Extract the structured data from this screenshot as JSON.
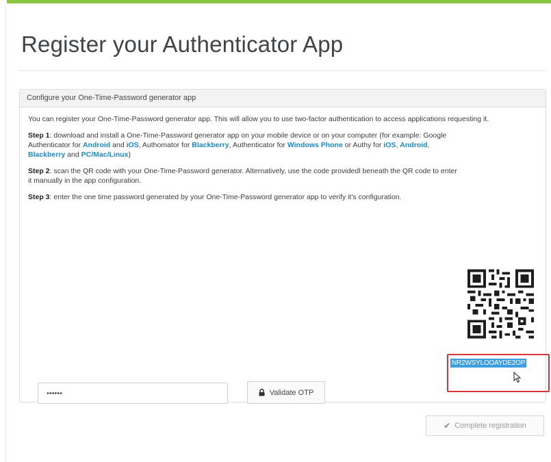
{
  "page": {
    "title": "Register your Authenticator App"
  },
  "panel": {
    "heading": "Configure your One-Time-Password generator app",
    "intro": "You can register your One-Time-Password generator app. This will allow you to use two-factor authentication to access applications requesting it.",
    "step1": {
      "label": "Step 1",
      "text_a": ": download and install a One-Time-Password generator app on your mobile device or on your computer (for example: Google Authenticator for ",
      "link_android": "Android",
      "text_b": " and ",
      "link_ios": "iOS",
      "text_c": ", Authomator for ",
      "link_blackberry": "Blackberry",
      "text_d": ", Authenticator for ",
      "link_windows_phone": "Windows Phone",
      "text_e": " or Authy for ",
      "link_authy_ios": "iOS",
      "text_f": ", ",
      "link_authy_android": "Android",
      "text_g": ", ",
      "link_authy_blackberry": "Blackberry",
      "text_h": " and ",
      "link_pc": "PC/Mac/Linux",
      "text_i": ")"
    },
    "step2": {
      "label": "Step 2",
      "text": ": scan the QR code with your One-Time-Password generator. Alternatively, use the code providedl beneath the QR code to enter it manually in the app configuration."
    },
    "step3": {
      "label": "Step 3",
      "text": ": enter the one time password generated by your One-Time-Password generator app to verify it's configuration."
    },
    "secret_key": "NR2WSYLOOAYDE2OP",
    "otp_value": "••••••",
    "validate_label": "Validate OTP"
  },
  "footer": {
    "complete_label": "Complete registration"
  },
  "colors": {
    "accent_bar": "#8cc63f",
    "link": "#1a88c9",
    "highlight_box": "#d9343a",
    "selection": "#3d9de0"
  },
  "icons": {
    "lock": "lock-icon",
    "check": "check-icon",
    "cursor": "mouse-cursor-icon",
    "qr": "qr-code"
  }
}
